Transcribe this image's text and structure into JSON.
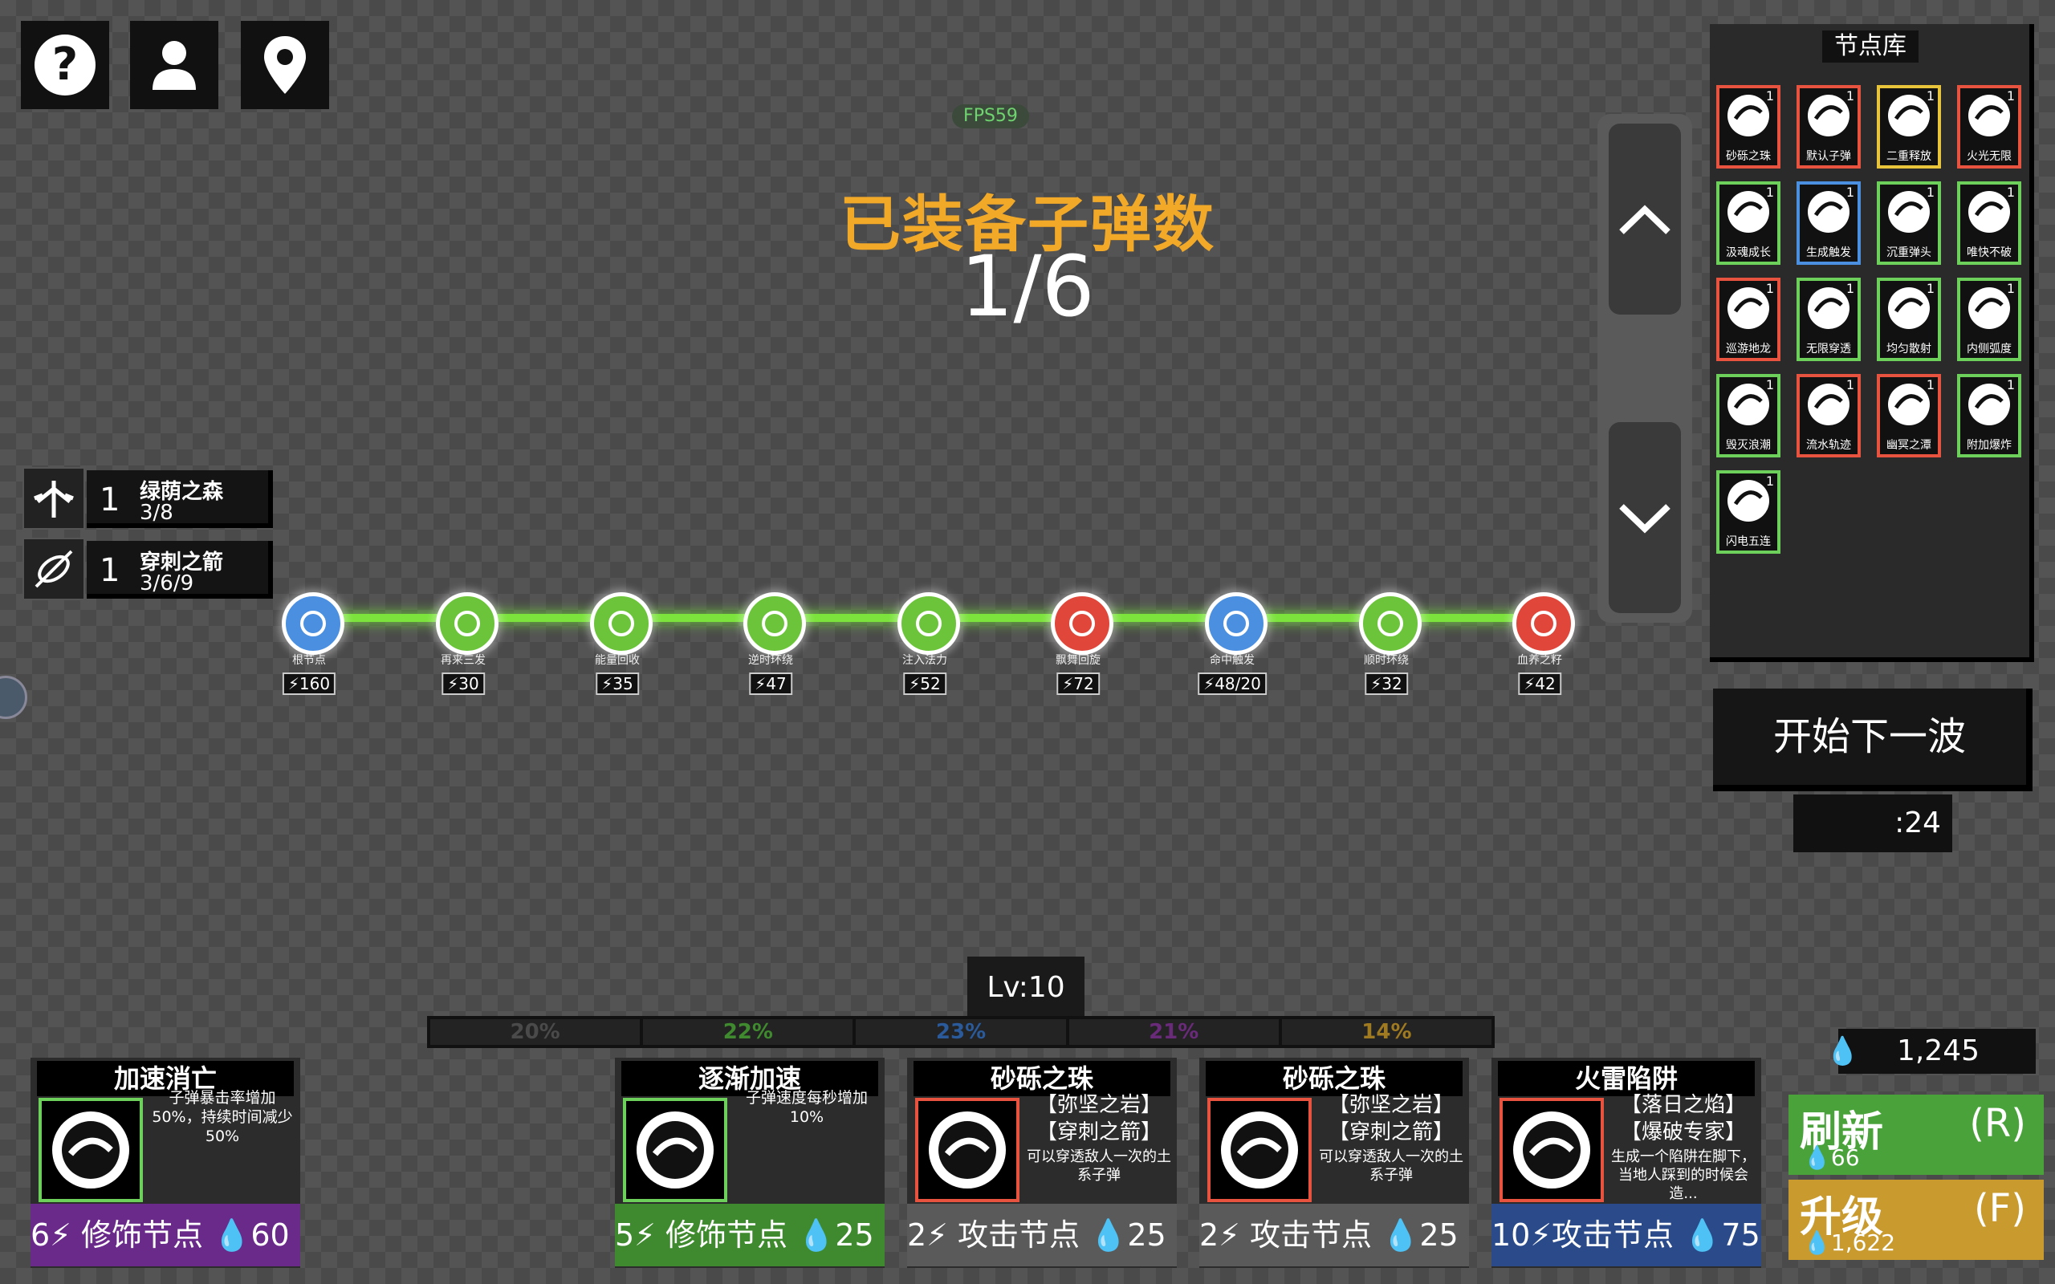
{
  "hud": {
    "fps": "FPS59",
    "title": "已装备子弹数",
    "ammo": "1/6",
    "level": "Lv:10",
    "timer": ":24",
    "money": "1,245"
  },
  "top_buttons": [
    {
      "icon": "help-icon"
    },
    {
      "icon": "profile-icon"
    },
    {
      "icon": "map-pin-icon"
    }
  ],
  "buffs": [
    {
      "count": "1",
      "name": "绿荫之森",
      "progress": "3/8"
    },
    {
      "count": "1",
      "name": "穿刺之箭",
      "progress": "3/6/9"
    }
  ],
  "chain": [
    {
      "label": "根节点",
      "cost": "160",
      "color": "#4a8fe0"
    },
    {
      "label": "再来三发",
      "cost": "30",
      "color": "#6cc43a"
    },
    {
      "label": "能量回收",
      "cost": "35",
      "color": "#6cc43a"
    },
    {
      "label": "逆时环绕",
      "cost": "47",
      "color": "#6cc43a"
    },
    {
      "label": "注入法力",
      "cost": "52",
      "color": "#6cc43a"
    },
    {
      "label": "飘舞回旋",
      "cost": "72",
      "color": "#e0473a"
    },
    {
      "label": "命中触发",
      "cost": "48/20",
      "color": "#4a8fe0"
    },
    {
      "label": "顺时环绕",
      "cost": "32",
      "color": "#6cc43a"
    },
    {
      "label": "血养之籽",
      "cost": "42",
      "color": "#e0473a"
    }
  ],
  "library": {
    "title": "节点库",
    "items": [
      {
        "name": "砂砾之珠",
        "border": "#e8533f"
      },
      {
        "name": "默认子弹",
        "border": "#e8533f"
      },
      {
        "name": "二重释放",
        "border": "#e8c43a"
      },
      {
        "name": "火光无限",
        "border": "#e8533f"
      },
      {
        "name": "汲魂成长",
        "border": "#6cd05a"
      },
      {
        "name": "生成触发",
        "border": "#4a8fe0"
      },
      {
        "name": "沉重弹头",
        "border": "#6cd05a"
      },
      {
        "name": "唯快不破",
        "border": "#6cd05a"
      },
      {
        "name": "巡游地龙",
        "border": "#e8533f"
      },
      {
        "name": "无限穿透",
        "border": "#6cd05a"
      },
      {
        "name": "均匀散射",
        "border": "#6cd05a"
      },
      {
        "name": "内侧弧度",
        "border": "#6cd05a"
      },
      {
        "name": "毁灭浪潮",
        "border": "#6cd05a"
      },
      {
        "name": "流水轨迹",
        "border": "#e8533f"
      },
      {
        "name": "幽冥之潭",
        "border": "#e8533f"
      },
      {
        "name": "附加爆炸",
        "border": "#6cd05a"
      },
      {
        "name": "闪电五连",
        "border": "#6cd05a"
      }
    ]
  },
  "next_wave": "开始下一波",
  "progress": [
    {
      "label": "20%",
      "color": "#4a4a4a"
    },
    {
      "label": "22%",
      "color": "#3f8a2e"
    },
    {
      "label": "23%",
      "color": "#2a5a9a"
    },
    {
      "label": "21%",
      "color": "#6a2a7a"
    },
    {
      "label": "14%",
      "color": "#a07a20"
    }
  ],
  "cards": [
    {
      "title": "加速消亡",
      "desc": "子弹暴击率增加50%，持续时间减少50%",
      "tags": "",
      "footer": "6⚡ 修饰节点 💧60",
      "icon": "hourglass-icon",
      "border": "#6cd05a",
      "footer_bg": "#6a2a8a"
    },
    {
      "title": "逐渐加速",
      "desc": "子弹速度每秒增加10%",
      "tags": "",
      "footer": "5⚡ 修饰节点 💧25",
      "icon": "speedometer-icon",
      "border": "#6cd05a",
      "footer_bg": "#3f8a2e"
    },
    {
      "title": "砂砾之珠",
      "desc": "可以穿透敌人一次的土系子弹",
      "tags": "【弥坚之岩】【穿刺之箭】",
      "footer": "2⚡ 攻击节点 💧25",
      "icon": "rock-orb-icon",
      "border": "#e8533f",
      "footer_bg": "#5a5a5a"
    },
    {
      "title": "砂砾之珠",
      "desc": "可以穿透敌人一次的土系子弹",
      "tags": "【弥坚之岩】【穿刺之箭】",
      "footer": "2⚡ 攻击节点 💧25",
      "icon": "rock-orb-icon",
      "border": "#e8533f",
      "footer_bg": "#5a5a5a"
    },
    {
      "title": "火雷陷阱",
      "desc": "生成一个陷阱在脚下，当地人踩到的时候会造...",
      "tags": "【落日之焰】【爆破专家】",
      "footer": "10⚡攻击节点 💧75",
      "icon": "fire-trap-icon",
      "border": "#e8533f",
      "footer_bg": "#2a4a8a"
    }
  ],
  "actions": {
    "refresh": {
      "label": "刷新",
      "key": "(R)",
      "cost": "66"
    },
    "upgrade": {
      "label": "升级",
      "key": "(F)",
      "cost": "1,622"
    }
  }
}
